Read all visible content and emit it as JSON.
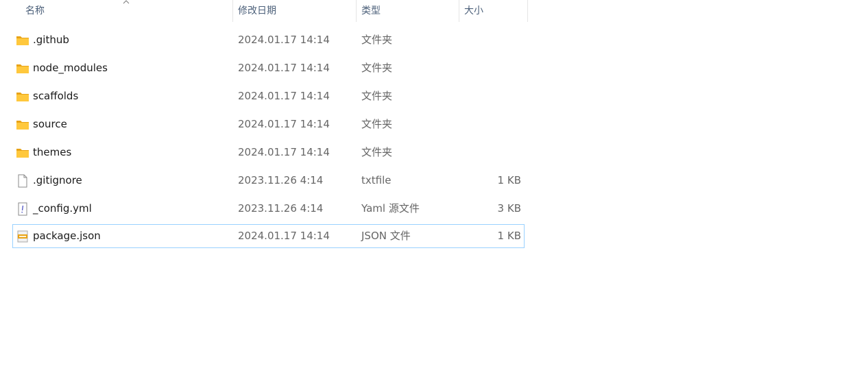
{
  "columns": {
    "name": "名称",
    "date": "修改日期",
    "type": "类型",
    "size": "大小"
  },
  "colors": {
    "folder": "#ffc83d",
    "folder_dark": "#e8a317",
    "selection_border": "#99d1ff",
    "header_text": "#4c607a"
  },
  "files": [
    {
      "name": ".github",
      "date": "2024.01.17 14:14",
      "type": "文件夹",
      "size": "",
      "icon": "folder-icon"
    },
    {
      "name": "node_modules",
      "date": "2024.01.17 14:14",
      "type": "文件夹",
      "size": "",
      "icon": "folder-icon"
    },
    {
      "name": "scaffolds",
      "date": "2024.01.17 14:14",
      "type": "文件夹",
      "size": "",
      "icon": "folder-icon"
    },
    {
      "name": "source",
      "date": "2024.01.17 14:14",
      "type": "文件夹",
      "size": "",
      "icon": "folder-icon"
    },
    {
      "name": "themes",
      "date": "2024.01.17 14:14",
      "type": "文件夹",
      "size": "",
      "icon": "folder-icon"
    },
    {
      "name": ".gitignore",
      "date": "2023.11.26 4:14",
      "type": "txtfile",
      "size": "1 KB",
      "icon": "text-file-icon"
    },
    {
      "name": "_config.yml",
      "date": "2023.11.26 4:14",
      "type": "Yaml 源文件",
      "size": "3 KB",
      "icon": "yaml-file-icon"
    },
    {
      "name": "package.json",
      "date": "2024.01.17 14:14",
      "type": "JSON 文件",
      "size": "1 KB",
      "icon": "json-file-icon"
    }
  ]
}
